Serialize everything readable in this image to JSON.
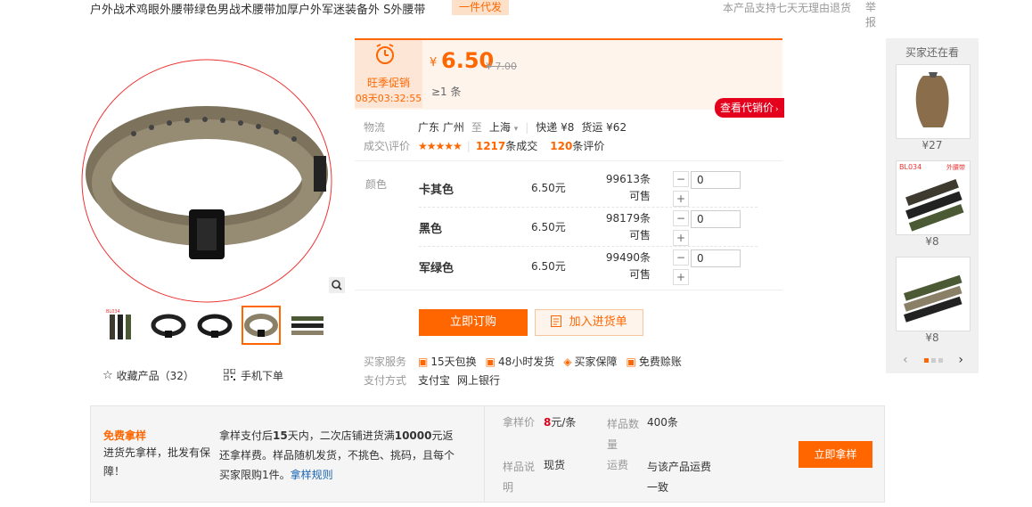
{
  "header": {
    "title": "户外战术鸡眼外腰带绿色男战术腰带加厚户外军迷装备外 S外腰带",
    "badge": "一件代发",
    "notice": "本产品支持七天无理由退货",
    "report": "举报"
  },
  "gallery": {
    "favorite_label": "收藏产品（32）",
    "mobile_label": "手机下单",
    "thumbs": [
      "thumb-1",
      "thumb-2",
      "thumb-3",
      "thumb-4",
      "thumb-5"
    ],
    "active_thumb_index": 3
  },
  "promo": {
    "name": "旺季促销",
    "countdown": "08天03:32:55",
    "currency": "¥",
    "price": "6.50",
    "original_price": "¥ 7.00",
    "min_qty": "≥1 条",
    "dai_button": "查看代销价"
  },
  "logistics": {
    "label": "物流",
    "from": "广东 广州",
    "to_word": "至",
    "to": "上海",
    "express": "快递 ¥8",
    "freight": "货运 ¥62"
  },
  "deals": {
    "label": "成交\\评价",
    "stars": "★★★★★",
    "deal_count": "1217",
    "deal_suffix": "条成交",
    "review_count": "120",
    "review_suffix": "条评价"
  },
  "skus": {
    "label": "颜色",
    "items": [
      {
        "name": "卡其色",
        "price": "6.50元",
        "stock": "99613条可售",
        "qty": "0"
      },
      {
        "name": "黑色",
        "price": "6.50元",
        "stock": "98179条可售",
        "qty": "0"
      },
      {
        "name": "军绿色",
        "price": "6.50元",
        "stock": "99490条可售",
        "qty": "0"
      }
    ]
  },
  "actions": {
    "order": "立即订购",
    "cart": "加入进货单"
  },
  "services": {
    "label": "买家服务",
    "items": [
      "15天包换",
      "48小时发货",
      "买家保障",
      "免费赊账"
    ],
    "pay_label": "支付方式",
    "pay_items": [
      "支付宝",
      "网上银行"
    ]
  },
  "sidebar": {
    "title": "买家还在看",
    "items": [
      {
        "price": "¥27"
      },
      {
        "price": "¥8",
        "tag_left": "BL034",
        "tag_right": "外腰带"
      },
      {
        "price": "¥8"
      }
    ]
  },
  "sample": {
    "logo": "免费拿样",
    "desc": "进货先拿样，批发有保障！",
    "text_1": "拿样支付后",
    "text_days": "15",
    "text_2": "天内，二次店铺进货满",
    "text_amount": "10000",
    "text_3": "元返还拿样费。样品随机发货，不挑色、挑码，且每个买家限购1件。",
    "rule_link": "拿样规则",
    "price_label": "拿样价",
    "price_value": "8",
    "price_unit": "元/条",
    "qty_label": "样品数量",
    "qty_value": "400条",
    "desc_label": "样品说明",
    "desc_value": "现货",
    "ship_label": "运费",
    "ship_value": "与该产品运费一致",
    "button": "立即拿样"
  },
  "colors": {
    "accent": "#ff6600",
    "red": "#e4001c",
    "link": "#1a66b3"
  }
}
